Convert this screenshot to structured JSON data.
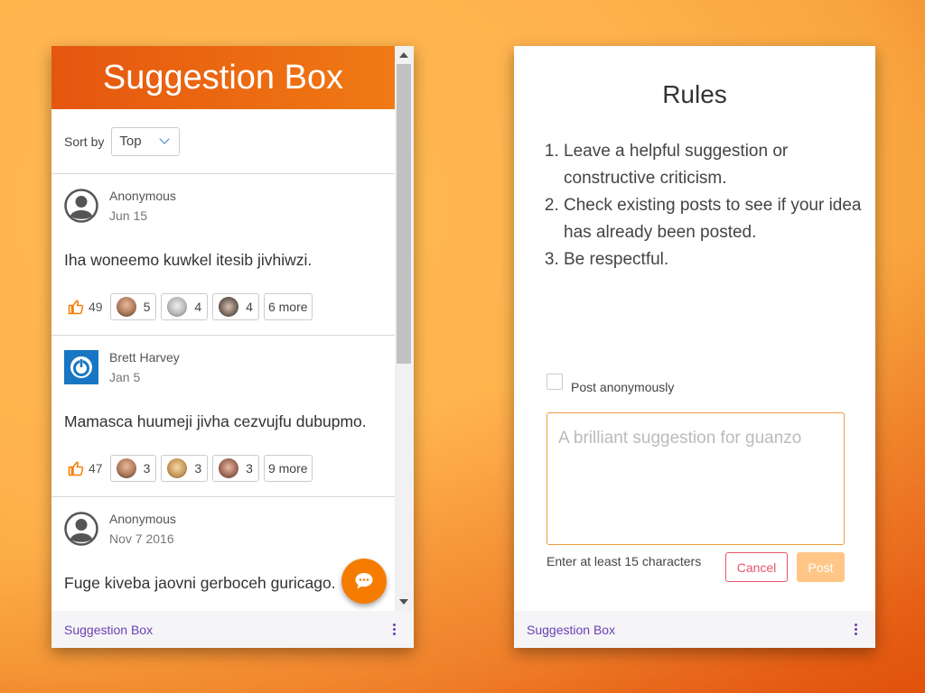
{
  "left_widget": {
    "header": {
      "title": "Suggestion Box"
    },
    "sort": {
      "label": "Sort by",
      "value": "Top"
    },
    "posts": [
      {
        "author": "Anonymous",
        "date": "Jun 15",
        "body": "Iha woneemo kuwkel itesib jivhiwzi.",
        "likes": "49",
        "reactions": [
          "5",
          "4",
          "4"
        ],
        "more": "6 more"
      },
      {
        "author": "Brett Harvey",
        "date": "Jan 5",
        "body": "Mamasca huumeji jivha cezvujfu dubupmo.",
        "likes": "47",
        "reactions": [
          "3",
          "3",
          "3"
        ],
        "more": "9 more"
      },
      {
        "author": "Anonymous",
        "date": "Nov 7 2016",
        "body": "Fuge kiveba jaovni gerboceh guricago."
      }
    ],
    "footer": {
      "label": "Suggestion Box"
    }
  },
  "right_widget": {
    "title": "Rules",
    "rules": [
      "Leave a helpful suggestion or constructive criticism.",
      "Check existing posts to see if your idea has already been posted.",
      "Be respectful."
    ],
    "anonymous_label": "Post anonymously",
    "textarea_placeholder": "A brilliant suggestion for guanzo",
    "hint": "Enter at least 15 characters",
    "cancel_label": "Cancel",
    "post_label": "Post",
    "footer": {
      "label": "Suggestion Box"
    }
  },
  "colors": {
    "accent": "#f57c00",
    "header_start": "#e5560f",
    "header_end": "#f07a14",
    "link_purple": "#6a3fb5",
    "cancel_red": "#e8536a",
    "post_disabled": "#ffc688"
  },
  "icons": {
    "like": "thumbs-up-icon",
    "fab": "chat-bubble-icon",
    "menu": "kebab-menu-icon",
    "anon_avatar": "user-circle-icon",
    "brand_avatar": "power-icon"
  }
}
